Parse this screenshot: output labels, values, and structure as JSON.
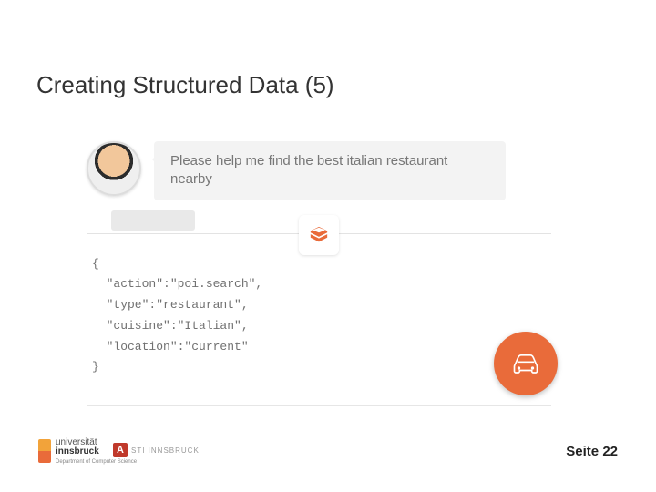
{
  "title": "Creating Structured Data (5)",
  "chat": {
    "message": "Please help me find the best italian restaurant nearby"
  },
  "code": {
    "open": "{",
    "l1": "  \"action\":\"poi.search\",",
    "l2": "  \"type\":\"restaurant\",",
    "l3": "  \"cuisine\":\"Italian\",",
    "l4": "  \"location\":\"current\"",
    "close": "}"
  },
  "footer": {
    "uni_top": "universität",
    "uni_bottom": "innsbruck",
    "uni_dept": "Department of Computer Science",
    "sti_mark": "A",
    "sti_text": "STI INNSBRUCK",
    "page_label": "Seite ",
    "page_num": "22"
  }
}
